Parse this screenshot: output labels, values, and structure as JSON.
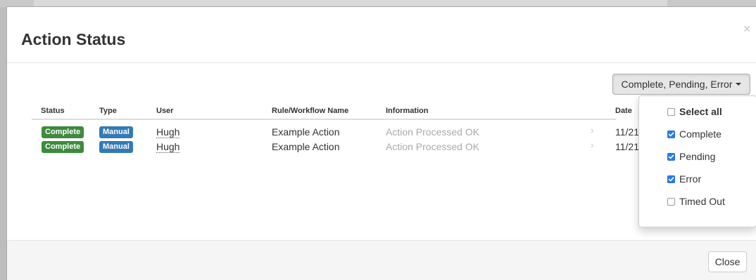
{
  "modal": {
    "title": "Action Status",
    "close_symbol": "×"
  },
  "filter": {
    "button_label": "Complete, Pending, Error",
    "options": [
      {
        "label": "Select all",
        "checked": false,
        "bold": true
      },
      {
        "label": "Complete",
        "checked": true,
        "bold": false
      },
      {
        "label": "Pending",
        "checked": true,
        "bold": false
      },
      {
        "label": "Error",
        "checked": true,
        "bold": false
      },
      {
        "label": "Timed Out",
        "checked": false,
        "bold": false
      }
    ]
  },
  "table": {
    "columns": [
      "Status",
      "Type",
      "User",
      "Rule/Workflow Name",
      "Information",
      "Date"
    ],
    "rows": [
      {
        "status": "Complete",
        "type": "Manual",
        "user": "Hugh",
        "rule": "Example Action",
        "information": "Action Processed OK",
        "chevron": "›",
        "date": "11/21"
      },
      {
        "status": "Complete",
        "type": "Manual",
        "user": "Hugh",
        "rule": "Example Action",
        "information": "Action Processed OK",
        "chevron": "›",
        "date": "11/21"
      }
    ]
  },
  "footer": {
    "close_label": "Close"
  },
  "colors": {
    "status_complete": "#3d8b3d",
    "type_manual": "#337ab7",
    "checkbox_checked": "#2b7de9"
  }
}
